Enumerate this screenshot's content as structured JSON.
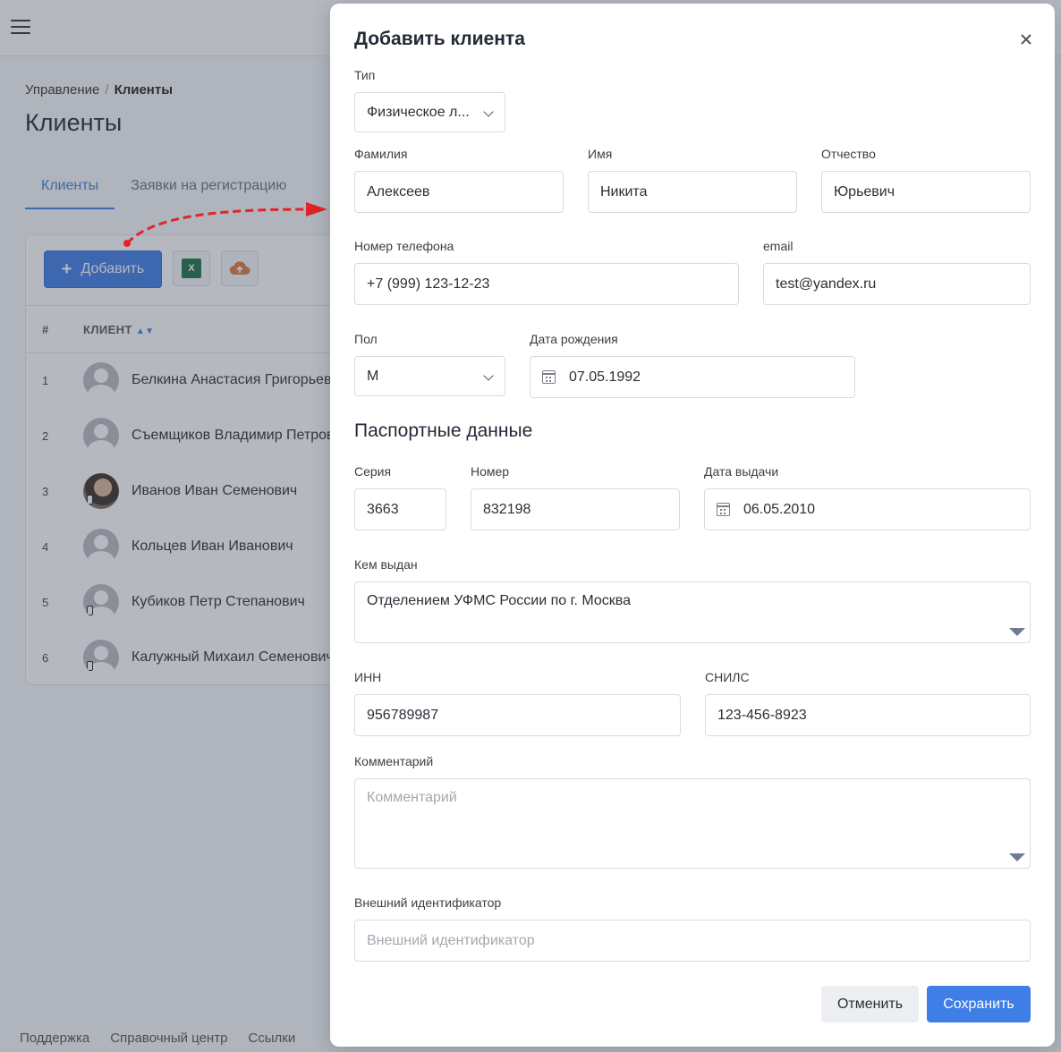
{
  "breadcrumb": {
    "parent": "Управление",
    "separator": "/",
    "current": "Клиенты"
  },
  "page_title": "Клиенты",
  "tabs": [
    {
      "label": "Клиенты",
      "active": true
    },
    {
      "label": "Заявки на регистрацию",
      "active": false
    }
  ],
  "toolbar": {
    "add_label": "Добавить",
    "excel_letter": "X"
  },
  "table": {
    "headers": {
      "num": "#",
      "client": "КЛИЕНТ"
    },
    "rows": [
      {
        "num": "1",
        "name": "Белкина Анастасия Григорьевна"
      },
      {
        "num": "2",
        "name": "Съемщиков Владимир Петрович"
      },
      {
        "num": "3",
        "name": "Иванов Иван Семенович"
      },
      {
        "num": "4",
        "name": "Кольцев Иван Иванович"
      },
      {
        "num": "5",
        "name": "Кубиков Петр Степанович"
      },
      {
        "num": "6",
        "name": "Калужный Михаил Семенович"
      }
    ]
  },
  "footer": {
    "support": "Поддержка",
    "help": "Справочный центр",
    "links": "Ссылки"
  },
  "modal": {
    "title": "Добавить клиента",
    "type": {
      "label": "Тип",
      "value": "Физическое л..."
    },
    "last_name": {
      "label": "Фамилия",
      "value": "Алексеев"
    },
    "first_name": {
      "label": "Имя",
      "value": "Никита"
    },
    "middle_name": {
      "label": "Отчество",
      "value": "Юрьевич"
    },
    "phone": {
      "label": "Номер телефона",
      "value": "+7 (999) 123-12-23"
    },
    "email": {
      "label": "email",
      "value": "test@yandex.ru"
    },
    "gender": {
      "label": "Пол",
      "value": "М"
    },
    "birth_date": {
      "label": "Дата рождения",
      "value": "07.05.1992"
    },
    "passport_section": "Паспортные данные",
    "series": {
      "label": "Серия",
      "value": "3663"
    },
    "number": {
      "label": "Номер",
      "value": "832198"
    },
    "issue_date": {
      "label": "Дата выдачи",
      "value": "06.05.2010"
    },
    "issued_by": {
      "label": "Кем выдан",
      "value": "Отделением УФМС России по г. Москва"
    },
    "inn": {
      "label": "ИНН",
      "value": "956789987"
    },
    "snils": {
      "label": "СНИЛС",
      "value": "123-456-8923"
    },
    "comment": {
      "label": "Комментарий",
      "placeholder": "Комментарий"
    },
    "external_id": {
      "label": "Внешний идентификатор",
      "placeholder": "Внешний идентификатор"
    },
    "cancel_label": "Отменить",
    "save_label": "Сохранить"
  },
  "colors": {
    "accent": "#3e7ee6",
    "annotation_arrow": "#e0242a"
  }
}
